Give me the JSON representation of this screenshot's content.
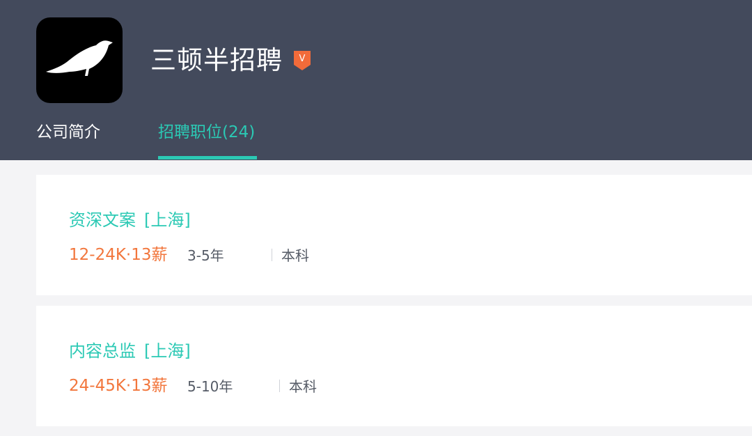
{
  "company": {
    "name": "三顿半招聘",
    "verified_badge": "V",
    "logo_icon": "bird-icon"
  },
  "tabs": [
    {
      "label": "公司简介",
      "active": false
    },
    {
      "label": "招聘职位(24)",
      "active": true
    }
  ],
  "jobs": [
    {
      "title": "资深文案",
      "location": "[上海]",
      "salary": "12-24K·13薪",
      "experience": "3-5年",
      "education": "本科"
    },
    {
      "title": "内容总监",
      "location": "[上海]",
      "salary": "24-45K·13薪",
      "experience": "5-10年",
      "education": "本科"
    }
  ],
  "colors": {
    "header_bg": "#434a5c",
    "accent": "#2bc9b4",
    "salary": "#f2763c",
    "badge": "#f26b3a"
  }
}
